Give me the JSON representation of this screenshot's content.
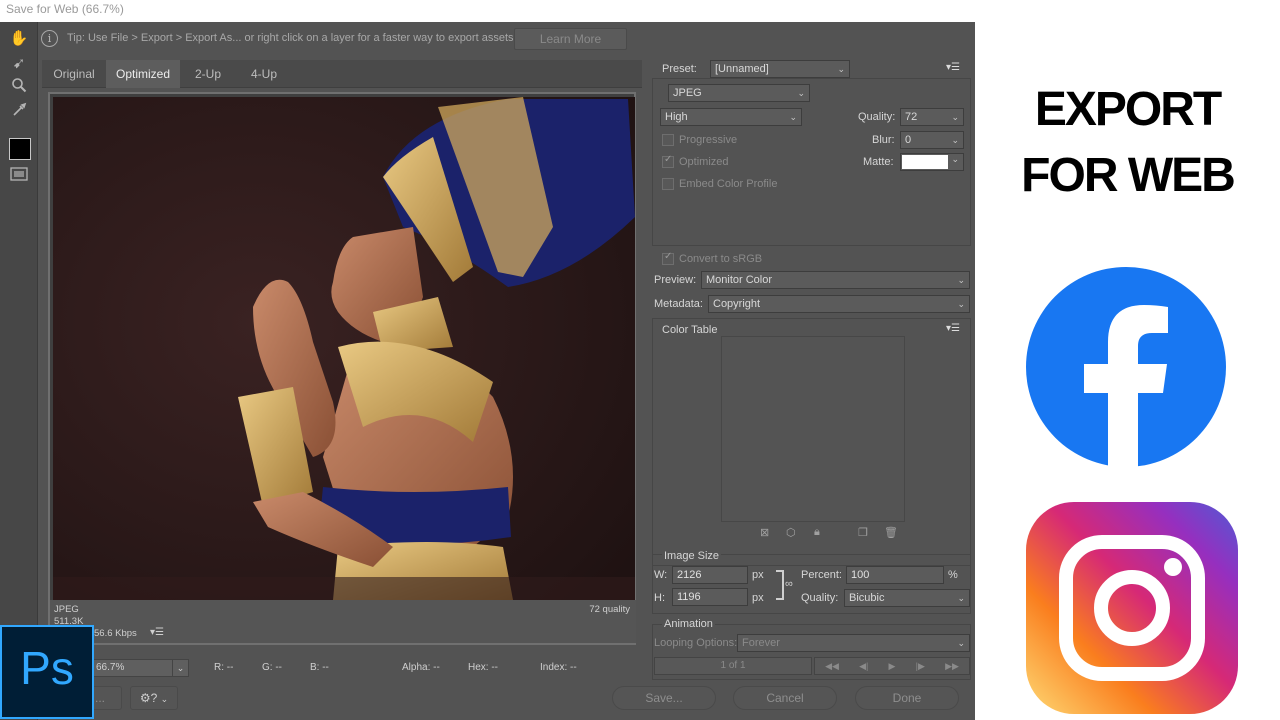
{
  "window": {
    "title": "Save for Web (66.7%)"
  },
  "tip": {
    "text": "Tip: Use File > Export > Export As...  or right click on a layer for a faster way to export assets",
    "learn_more": "Learn More"
  },
  "tabs": [
    "Original",
    "Optimized",
    "2-Up",
    "4-Up"
  ],
  "image_info": {
    "format": "JPEG",
    "size": "511.3K",
    "speed": "56.6 Kbps",
    "quality": "72 quality"
  },
  "status": {
    "zoom": "66.7%",
    "r": "R: --",
    "g": "G: --",
    "b": "B: --",
    "alpha": "Alpha: --",
    "hex": "Hex: --",
    "index": "Index: --"
  },
  "buttons": {
    "save": "Save...",
    "cancel": "Cancel",
    "done": "Done",
    "preview_partial": "..."
  },
  "settings": {
    "preset_label": "Preset:",
    "preset_value": "[Unnamed]",
    "format": "JPEG",
    "compression": "High",
    "quality_label": "Quality:",
    "quality_value": "72",
    "blur_label": "Blur:",
    "blur_value": "0",
    "matte_label": "Matte:",
    "progressive": "Progressive",
    "optimized": "Optimized",
    "embed_profile": "Embed Color Profile",
    "convert_srgb": "Convert to sRGB",
    "preview_label": "Preview:",
    "preview_value": "Monitor Color",
    "metadata_label": "Metadata:",
    "metadata_value": "Copyright"
  },
  "color_table": {
    "title": "Color Table"
  },
  "image_size": {
    "title": "Image Size",
    "w_label": "W:",
    "w_value": "2126",
    "h_label": "H:",
    "h_value": "1196",
    "unit": "px",
    "percent_label": "Percent:",
    "percent_value": "100",
    "percent_unit": "%",
    "quality_label": "Quality:",
    "quality_value": "Bicubic"
  },
  "animation": {
    "title": "Animation",
    "looping_label": "Looping Options:",
    "looping_value": "Forever",
    "frame": "1 of 1"
  },
  "overlay": {
    "heading_line1": "EXPORT",
    "heading_line2": "FOR WEB",
    "ps_logo": "Ps"
  },
  "colors": {
    "facebook": "#1877f2",
    "dialog_bg": "#535353"
  }
}
